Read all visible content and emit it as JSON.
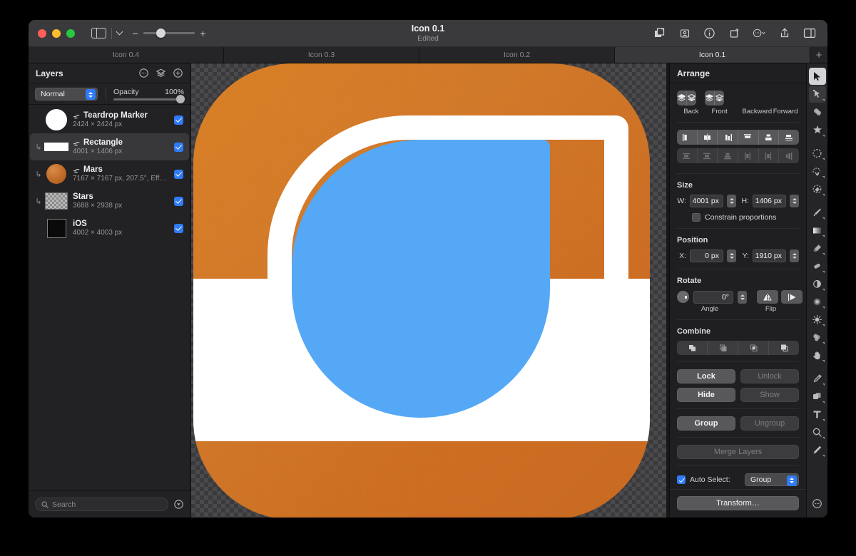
{
  "window": {
    "traffic_lights": [
      "close",
      "minimize",
      "zoom"
    ],
    "document_name": "Icon 0.1",
    "document_status": "Edited",
    "zoom_minus": "−",
    "zoom_plus": "+",
    "toolbar_icons": [
      "duplicate-icon",
      "persona-icon",
      "info-icon",
      "crop-rotate-icon",
      "more-options-icon",
      "share-icon",
      "right-panel-icon"
    ]
  },
  "tabs": {
    "items": [
      {
        "label": "Icon 0.4",
        "active": false
      },
      {
        "label": "Icon 0.3",
        "active": false
      },
      {
        "label": "Icon 0.2",
        "active": false
      },
      {
        "label": "Icon 0.1",
        "active": true
      }
    ],
    "add_label": "+"
  },
  "layers_panel": {
    "title": "Layers",
    "header_icons": [
      "more-options-icon",
      "layer-effects-icon",
      "add-layer-icon"
    ],
    "blend_mode": "Normal",
    "opacity_label": "Opacity",
    "opacity_value": "100%",
    "items": [
      {
        "name": "Teardrop Marker",
        "meta": "2424 × 2424 px",
        "thumb": "circle-white",
        "selected": false,
        "has_disclosure": false,
        "visible": true
      },
      {
        "name": "Rectangle",
        "meta": "4001 × 1406 px",
        "thumb": "rect-white",
        "selected": true,
        "has_disclosure": true,
        "visible": true
      },
      {
        "name": "Mars",
        "meta": "7167 × 7167 px, 207.5°, Eff…",
        "thumb": "mars",
        "selected": false,
        "has_disclosure": true,
        "visible": true
      },
      {
        "name": "Stars",
        "meta": "3688 × 2938 px",
        "thumb": "checker",
        "selected": false,
        "has_disclosure": true,
        "visible": true
      },
      {
        "name": "iOS",
        "meta": "4002 × 4003 px",
        "thumb": "ios",
        "selected": false,
        "has_disclosure": false,
        "visible": true
      }
    ],
    "search_placeholder": "Search"
  },
  "canvas": {
    "artwork_name": "app-icon-artwork",
    "background_color": "#d2792a",
    "accent_color": "#55a8f5",
    "band_color": "#ffffff"
  },
  "inspector": {
    "title": "Arrange",
    "order": {
      "back": "Back",
      "front": "Front",
      "backward": "Backward",
      "forward": "Forward"
    },
    "align_top_row": [
      "align-left-icon",
      "align-center-horizontal-icon",
      "align-right-icon",
      "align-top-icon",
      "align-middle-vertical-icon",
      "align-bottom-icon"
    ],
    "align_bottom_row": [
      "distribute-top-icon",
      "distribute-middle-icon",
      "distribute-bottom-icon",
      "distribute-left-icon",
      "distribute-center-icon",
      "distribute-right-icon"
    ],
    "size": {
      "label": "Size",
      "w_label": "W:",
      "w_value": "4001 px",
      "h_label": "H:",
      "h_value": "1406 px",
      "constrain_label": "Constrain proportions",
      "constrain_checked": false
    },
    "position": {
      "label": "Position",
      "x_label": "X:",
      "x_value": "0 px",
      "y_label": "Y:",
      "y_value": "1910 px"
    },
    "rotate": {
      "label": "Rotate",
      "angle_value": "0°",
      "angle_caption": "Angle",
      "flip_caption": "Flip",
      "flip_icons": [
        "flip-vertical-icon",
        "flip-horizontal-icon"
      ]
    },
    "combine": {
      "label": "Combine",
      "icons": [
        "combine-add-icon",
        "combine-subtract-icon",
        "combine-intersect-icon",
        "combine-divide-icon"
      ]
    },
    "actions": {
      "lock": "Lock",
      "unlock": "Unlock",
      "hide": "Hide",
      "show": "Show",
      "group": "Group",
      "ungroup": "Ungroup",
      "merge_layers": "Merge Layers"
    },
    "auto_select": {
      "label": "Auto Select:",
      "checked": true,
      "value": "Group"
    },
    "transform_button": "Transform…"
  },
  "tools": {
    "items": [
      {
        "name": "move-tool",
        "active": true
      },
      {
        "name": "node-tool",
        "active": false,
        "sub": true
      },
      {
        "name": "shape-builder-tool",
        "active": false
      },
      {
        "name": "star-shape-tool",
        "active": false
      },
      {
        "name": "marquee-select-tool",
        "active": false
      },
      {
        "name": "freehand-select-tool",
        "active": false
      },
      {
        "name": "flood-select-tool",
        "active": false
      },
      {
        "name": "paint-brush-tool",
        "active": false
      },
      {
        "name": "gradient-tool",
        "active": false
      },
      {
        "name": "eraser-tool",
        "active": false
      },
      {
        "name": "inpainting-brush-tool",
        "active": false
      },
      {
        "name": "dodge-burn-tool",
        "active": false
      },
      {
        "name": "blur-tool",
        "active": false
      },
      {
        "name": "sharpen-tool",
        "active": false
      },
      {
        "name": "smudge-tool",
        "active": false
      },
      {
        "name": "hand-tool",
        "active": false
      },
      {
        "name": "pen-tool",
        "active": false
      },
      {
        "name": "rectangle-tool",
        "active": false
      },
      {
        "name": "text-tool",
        "active": false
      },
      {
        "name": "zoom-tool",
        "active": false
      },
      {
        "name": "pencil-tool",
        "active": false
      },
      {
        "name": "more-tools-icon",
        "active": false
      }
    ]
  }
}
